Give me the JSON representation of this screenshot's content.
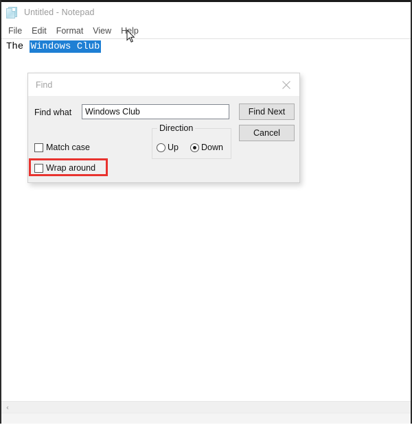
{
  "window": {
    "title": "Untitled - Notepad",
    "icon": "notepad-icon",
    "menu": [
      "File",
      "Edit",
      "Format",
      "View",
      "Help"
    ],
    "document": {
      "prefix_text": "The ",
      "selected_text": "Windows Club",
      "selection_color": "#1e7fd4"
    },
    "scrollbar": {
      "left_arrow_glyph": "‹"
    }
  },
  "find_dialog": {
    "title": "Find",
    "close_glyph": "close-icon",
    "find_what_label": "Find what",
    "find_what_value": "Windows Club",
    "find_what_placeholder": "",
    "buttons": {
      "find_next": "Find Next",
      "cancel": "Cancel"
    },
    "direction": {
      "legend": "Direction",
      "options": [
        {
          "label": "Up",
          "checked": false
        },
        {
          "label": "Down",
          "checked": true
        }
      ]
    },
    "checkboxes": [
      {
        "label": "Match case",
        "checked": false
      },
      {
        "label": "Wrap around",
        "checked": false
      }
    ]
  },
  "annotation": {
    "highlight_target": "Wrap around",
    "highlight_color": "#e8332f"
  }
}
